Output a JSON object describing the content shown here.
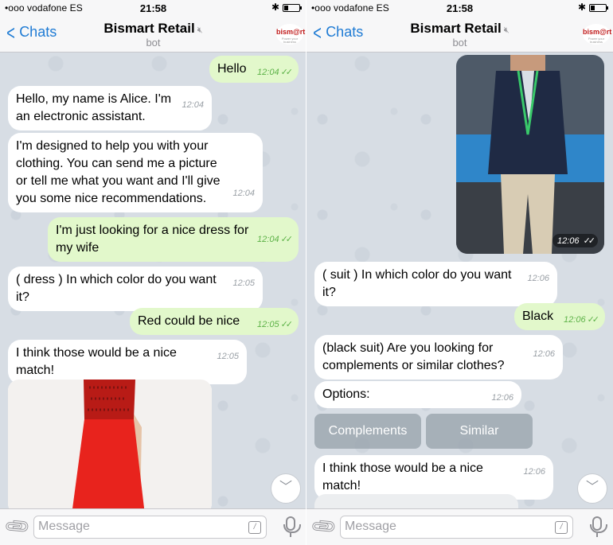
{
  "status": {
    "carrier": "•ooo vodafone ES",
    "time": "21:58",
    "bluetooth": "✱",
    "battery_level": 0.3
  },
  "header": {
    "back_label": "Chats",
    "title": "Bismart Retail",
    "subtitle": "bot",
    "logo_text": "bism@rt",
    "logo_tagline": "Power your business"
  },
  "input": {
    "placeholder": "Message"
  },
  "left": {
    "messages": [
      {
        "text": "Hello",
        "time": "12:04"
      },
      {
        "text": "Hello, my name is Alice. I'm an electronic assistant.",
        "time": "12:04"
      },
      {
        "text": "I'm designed to help you with your clothing. You can send me a picture or tell me what you want and I'll give you some nice recommendations.",
        "time": "12:04"
      },
      {
        "text": "I'm just looking for a nice dress for my wife",
        "time": "12:04"
      },
      {
        "text": "( dress ) In which color do you want it?",
        "time": "12:05"
      },
      {
        "text": "Red could be nice",
        "time": "12:05"
      },
      {
        "text": "I think those would be a nice match!",
        "time": "12:05"
      }
    ]
  },
  "right": {
    "photo_time": "12:06",
    "messages": [
      {
        "text": "( suit ) In which color do you want it?",
        "time": "12:06"
      },
      {
        "text": "Black",
        "time": "12:06"
      },
      {
        "text": "(black suit) Are you looking for complements or similar clothes?",
        "time": "12:06"
      },
      {
        "text": "Options:",
        "time": "12:06"
      },
      {
        "text": "I think those would be a nice match!",
        "time": "12:06"
      }
    ],
    "buttons": [
      "Complements",
      "Similar"
    ]
  },
  "colors": {
    "accent": "#1e7bd4",
    "outgoing_bubble": "#e2f8cb",
    "incoming_bubble": "#ffffff",
    "chat_bg": "#d7dde4",
    "read_check": "#5db248",
    "dress": "#e8231d"
  }
}
